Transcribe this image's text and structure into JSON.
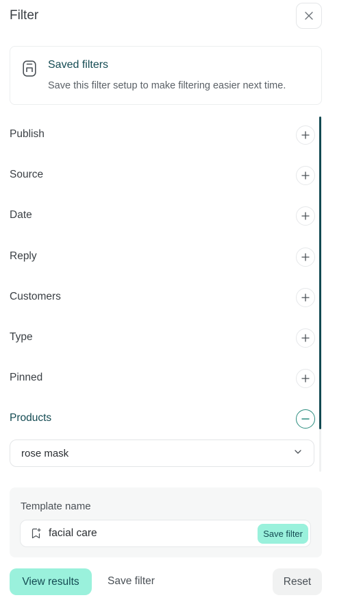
{
  "header": {
    "title": "Filter",
    "close_icon": "close-icon"
  },
  "saved_filters": {
    "icon": "bookmark-icon",
    "title": "Saved filters",
    "description": "Save this filter setup to make filtering easier next time."
  },
  "filters": {
    "items": [
      {
        "label": "Publish",
        "expanded": false
      },
      {
        "label": "Source",
        "expanded": false
      },
      {
        "label": "Date",
        "expanded": false
      },
      {
        "label": "Reply",
        "expanded": false
      },
      {
        "label": "Customers",
        "expanded": false
      },
      {
        "label": "Type",
        "expanded": false
      },
      {
        "label": "Pinned",
        "expanded": false
      },
      {
        "label": "Products",
        "expanded": true
      }
    ],
    "products_select": {
      "value": "rose mask"
    }
  },
  "template": {
    "label": "Template name",
    "value": "facial care",
    "save_button": "Save filter"
  },
  "footer": {
    "view_results": "View results",
    "save_filter": "Save filter",
    "reset": "Reset"
  },
  "colors": {
    "accent": "#9af1dc",
    "accent_text": "#134a52",
    "active_label": "#134a52",
    "scroll_thumb": "#134a52"
  }
}
